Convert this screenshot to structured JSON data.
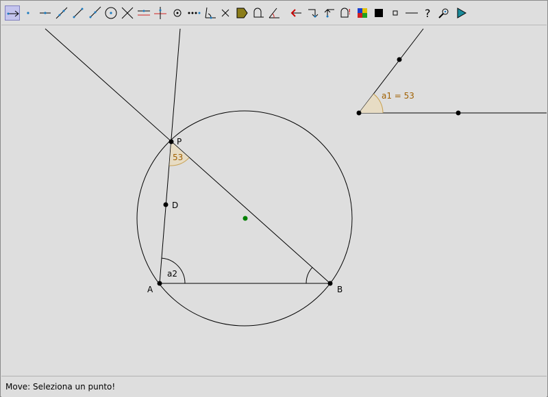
{
  "toolbar": {
    "tools": [
      {
        "name": "move-tool",
        "icon": "move-arrow-icon",
        "active": true
      },
      {
        "name": "new-point-tool",
        "icon": "point-icon"
      },
      {
        "name": "midpoint-tool",
        "icon": "midpoint-icon"
      },
      {
        "name": "line-two-points-tool",
        "icon": "line-icon"
      },
      {
        "name": "segment-tool",
        "icon": "segment-icon"
      },
      {
        "name": "ray-tool",
        "icon": "ray-icon"
      },
      {
        "name": "circle-center-tool",
        "icon": "circle-icon"
      },
      {
        "name": "intersect-tool",
        "icon": "intersect-icon"
      },
      {
        "name": "parallel-line-tool",
        "icon": "parallel-icon"
      },
      {
        "name": "perpendicular-line-tool",
        "icon": "perpendicular-icon"
      },
      {
        "name": "circle-point-tool",
        "icon": "circle-point-icon"
      },
      {
        "name": "polygon-tool",
        "icon": "polygon-dots-icon"
      },
      {
        "name": "angle-tool",
        "icon": "angle-icon"
      },
      {
        "name": "delete-tool",
        "icon": "x-icon"
      },
      {
        "name": "fill-tool",
        "icon": "fill-icon"
      },
      {
        "name": "text-tool",
        "icon": "text-icon"
      },
      {
        "name": "angle-measure-tool",
        "icon": "angle-measure-icon"
      },
      {
        "name": "undo-tool",
        "icon": "arrow-left-icon"
      },
      {
        "name": "redo-tool",
        "icon": "redo-icon"
      },
      {
        "name": "transform-tool",
        "icon": "transform-icon"
      },
      {
        "name": "check-tool",
        "icon": "check-icon"
      },
      {
        "name": "color-tool",
        "icon": "color-palette-icon"
      },
      {
        "name": "fill-black-tool",
        "icon": "black-square-icon"
      },
      {
        "name": "point-style-tool",
        "icon": "small-square-icon"
      },
      {
        "name": "line-style-tool",
        "icon": "line-style-icon"
      },
      {
        "name": "help-tool",
        "icon": "question-icon"
      },
      {
        "name": "zoom-tool",
        "icon": "magnifier-icon"
      },
      {
        "name": "play-tool",
        "icon": "play-icon"
      }
    ]
  },
  "canvas": {
    "labels": {
      "P": "P",
      "A": "A",
      "B": "B",
      "D": "D",
      "angle_p": "53",
      "angle_a": "a2",
      "angle_a1": "a1 = 53"
    },
    "colors": {
      "line": "#000000",
      "point": "#000000",
      "center_point": "#008000",
      "angle_fill": "#e7dcc4",
      "angle_stroke": "#c8a050",
      "angle_text": "#a06000"
    }
  },
  "status": {
    "text": "Move: Seleziona un punto!"
  }
}
